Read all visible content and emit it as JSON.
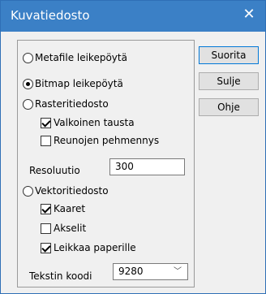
{
  "window": {
    "title": "Kuvatiedosto"
  },
  "group": {
    "metafile_label": "Metafile leikepöytä",
    "bitmap_label": "Bitmap leikepöytä",
    "raster_label": "Rasteritiedosto",
    "white_bg_label": "Valkoinen tausta",
    "antialias_label": "Reunojen pehmennys",
    "resolution_label": "Resoluutio",
    "resolution_value": "300",
    "vector_label": "Vektoritiedosto",
    "arcs_label": "Kaaret",
    "axes_label": "Akselit",
    "clip_label": "Leikkaa paperille",
    "text_code_label": "Tekstin koodi",
    "text_code_value": "9280"
  },
  "buttons": {
    "run": "Suorita",
    "close": "Sulje",
    "help": "Ohje"
  },
  "icons": {
    "close": "close-icon",
    "dropdown": "chevron-down-icon"
  },
  "colors": {
    "titlebar": "#3b80c6",
    "background": "#f0f0f0",
    "default_button_border": "#0078d7"
  }
}
